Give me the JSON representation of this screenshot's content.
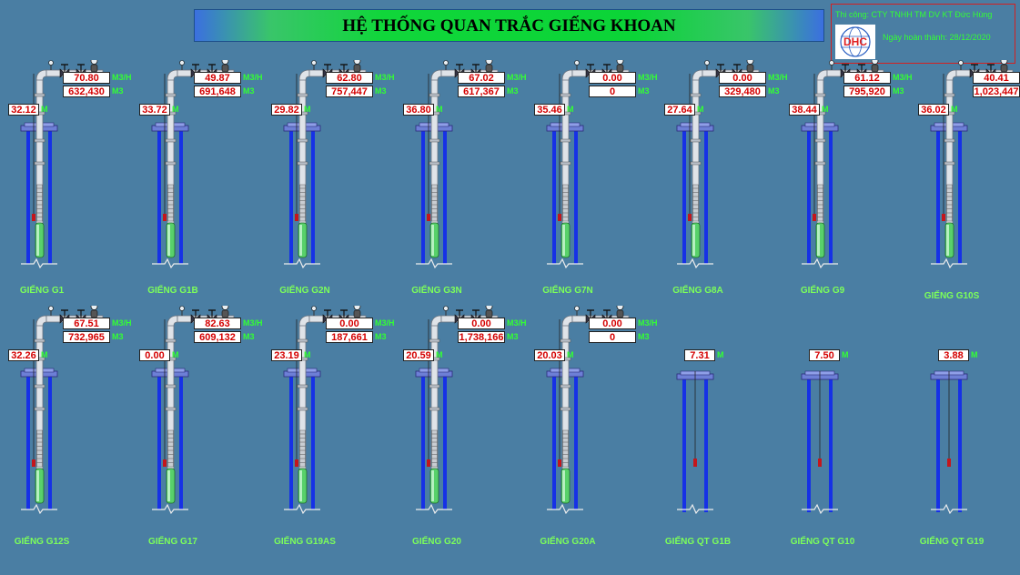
{
  "title": "HỆ THỐNG QUAN TRẮC GIẾNG KHOAN",
  "info": {
    "contractor": "Thi công: CTY TNHH TM DV KT Đức Hùng",
    "completion": "Ngày hoàn thành: 28/12/2020",
    "logo_text": "DHC"
  },
  "units": {
    "flow": "M3/H",
    "volume": "M3",
    "level": "M"
  },
  "colors": {
    "background": "#4a7ea3",
    "value_text": "#d40000",
    "label_green": "#7cff5a",
    "casing_blue": "#1631e6"
  },
  "wells": [
    {
      "name": "GIẾNG G1",
      "level": "32.12",
      "flow": "70.80",
      "volume": "632,430",
      "pump": true
    },
    {
      "name": "GIẾNG G1B",
      "level": "33.72",
      "flow": "49.87",
      "volume": "691,648",
      "pump": true
    },
    {
      "name": "GIẾNG G2N",
      "level": "29.82",
      "flow": "62.80",
      "volume": "757,447",
      "pump": true
    },
    {
      "name": "GIẾNG G3N",
      "level": "36.80",
      "flow": "67.02",
      "volume": "617,367",
      "pump": true
    },
    {
      "name": "GIẾNG G7N",
      "level": "35.46",
      "flow": "0.00",
      "volume": "0",
      "pump": true
    },
    {
      "name": "GIẾNG G8A",
      "level": "27.64",
      "flow": "0.00",
      "volume": "329,480",
      "pump": true
    },
    {
      "name": "GIẾNG G9",
      "level": "38.44",
      "flow": "61.12",
      "volume": "795,920",
      "pump": true
    },
    {
      "name": "GIẾNG G10S",
      "level": "36.02",
      "flow": "40.41",
      "volume": "1,023,447",
      "pump": true
    },
    {
      "name": "GIẾNG G12S",
      "level": "32.26",
      "flow": "67.51",
      "volume": "732,965",
      "pump": true
    },
    {
      "name": "GIẾNG G17",
      "level": "0.00",
      "flow": "82.63",
      "volume": "609,132",
      "pump": true
    },
    {
      "name": "GIẾNG G19AS",
      "level": "23.19",
      "flow": "0.00",
      "volume": "187,661",
      "pump": true
    },
    {
      "name": "GIẾNG G20",
      "level": "20.59",
      "flow": "0.00",
      "volume": "1,738,166",
      "pump": true
    },
    {
      "name": "GIẾNG G20A",
      "level": "20.03",
      "flow": "0.00",
      "volume": "0",
      "pump": true
    },
    {
      "name": "GIẾNG QT G1B",
      "level": "7.31",
      "pump": false
    },
    {
      "name": "GIẾNG QT G10",
      "level": "7.50",
      "pump": false
    },
    {
      "name": "GIẾNG QT G19",
      "level": "3.88",
      "pump": false
    }
  ]
}
